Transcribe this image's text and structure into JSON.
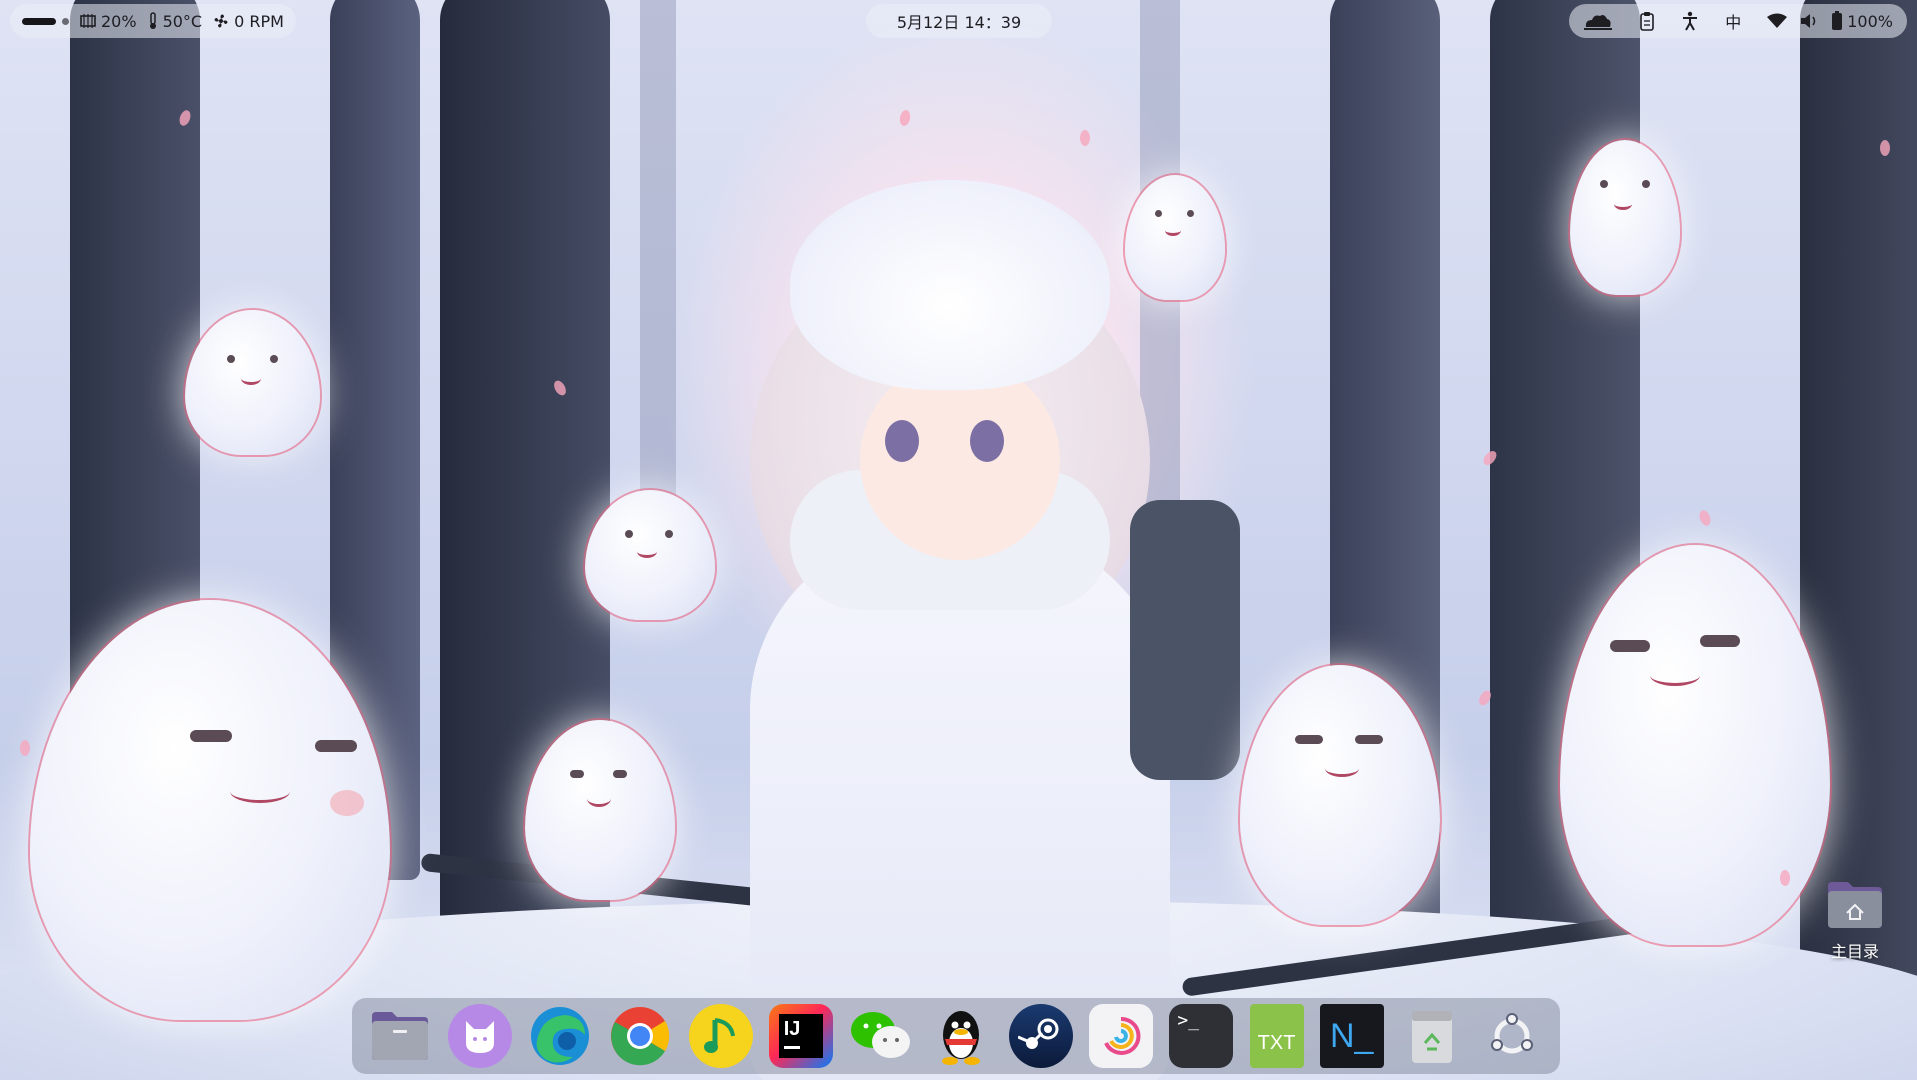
{
  "topbar": {
    "left": {
      "cpu": "20%",
      "temp": "50°C",
      "fan": "0 RPM"
    },
    "datetime": "5月12日  14：39",
    "right": {
      "input_method": "中",
      "battery": "100%"
    }
  },
  "desktop": {
    "home_folder_label": "主目录"
  },
  "dock": {
    "apps": [
      {
        "name": "files",
        "icon": "folder-icon"
      },
      {
        "name": "cat",
        "icon": "cat-app-icon"
      },
      {
        "name": "edge",
        "icon": "edge-browser-icon"
      },
      {
        "name": "chrome",
        "icon": "chrome-browser-icon"
      },
      {
        "name": "music",
        "icon": "music-note-icon"
      },
      {
        "name": "intellij",
        "icon": "intellij-icon",
        "label": "IJ"
      },
      {
        "name": "wechat",
        "icon": "wechat-icon"
      },
      {
        "name": "qq",
        "icon": "qq-penguin-icon"
      },
      {
        "name": "steam",
        "icon": "steam-icon"
      },
      {
        "name": "swirl",
        "icon": "color-swirl-icon"
      },
      {
        "name": "terminal",
        "icon": "terminal-icon",
        "label": ">_"
      },
      {
        "name": "text",
        "icon": "txt-file-icon",
        "label": "TXT"
      },
      {
        "name": "neovim",
        "icon": "n-editor-icon",
        "label": "N_"
      },
      {
        "name": "trash",
        "icon": "trash-icon"
      },
      {
        "name": "ubuntu",
        "icon": "ubuntu-icon"
      }
    ]
  },
  "colors": {
    "accent_pink": "#e75a78",
    "dock_bg": "#5a6076"
  }
}
